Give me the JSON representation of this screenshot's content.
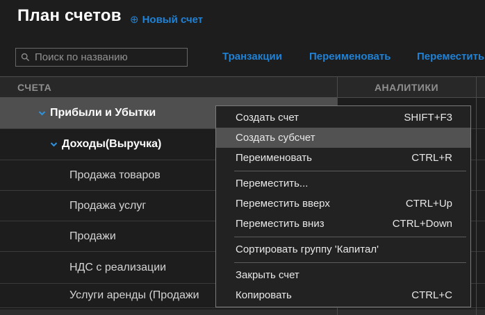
{
  "header": {
    "title": "План счетов",
    "new_account_label": "Новый счет",
    "plus_glyph": "⊕",
    "search_placeholder": "Поиск по названию",
    "actions": [
      "Транзакции",
      "Переименовать",
      "Переместить"
    ]
  },
  "table": {
    "columns": {
      "accounts": "СЧЕТА",
      "analytics": "АНАЛИТИКИ"
    },
    "rows": [
      {
        "label": "Прибыли и Убытки",
        "level": 0,
        "expanded": true,
        "parent": true,
        "selected": true
      },
      {
        "label": "Доходы(Выручка)",
        "level": 1,
        "expanded": true,
        "parent": true
      },
      {
        "label": "Продажа товаров",
        "level": 2
      },
      {
        "label": "Продажа услуг",
        "level": 2
      },
      {
        "label": "Продажи",
        "level": 2
      },
      {
        "label": "НДС с реализации",
        "level": 2
      },
      {
        "label": "Услуги аренды (Продажи",
        "level": 2
      }
    ]
  },
  "context_menu": {
    "items": [
      {
        "label": "Создать счет",
        "shortcut": "SHIFT+F3"
      },
      {
        "label": "Создать субсчет",
        "shortcut": "",
        "highlighted": true
      },
      {
        "label": "Переименовать",
        "shortcut": "CTRL+R"
      },
      {
        "separator": true
      },
      {
        "label": "Переместить...",
        "shortcut": ""
      },
      {
        "label": "Переместить вверх",
        "shortcut": "CTRL+Up"
      },
      {
        "label": "Переместить вниз",
        "shortcut": "CTRL+Down"
      },
      {
        "separator": true
      },
      {
        "label": "Сортировать группу 'Капитал'",
        "shortcut": ""
      },
      {
        "separator": true
      },
      {
        "label": "Закрыть счет",
        "shortcut": ""
      },
      {
        "label": "Копировать",
        "shortcut": "CTRL+C"
      }
    ]
  },
  "colors": {
    "accent_blue": "#1f82d6",
    "chevron_blue": "#2f94e0",
    "selected_row": "#4f4f4f",
    "menu_highlight": "#525252",
    "background": "#1d1d1d",
    "header_band": "#282828"
  }
}
